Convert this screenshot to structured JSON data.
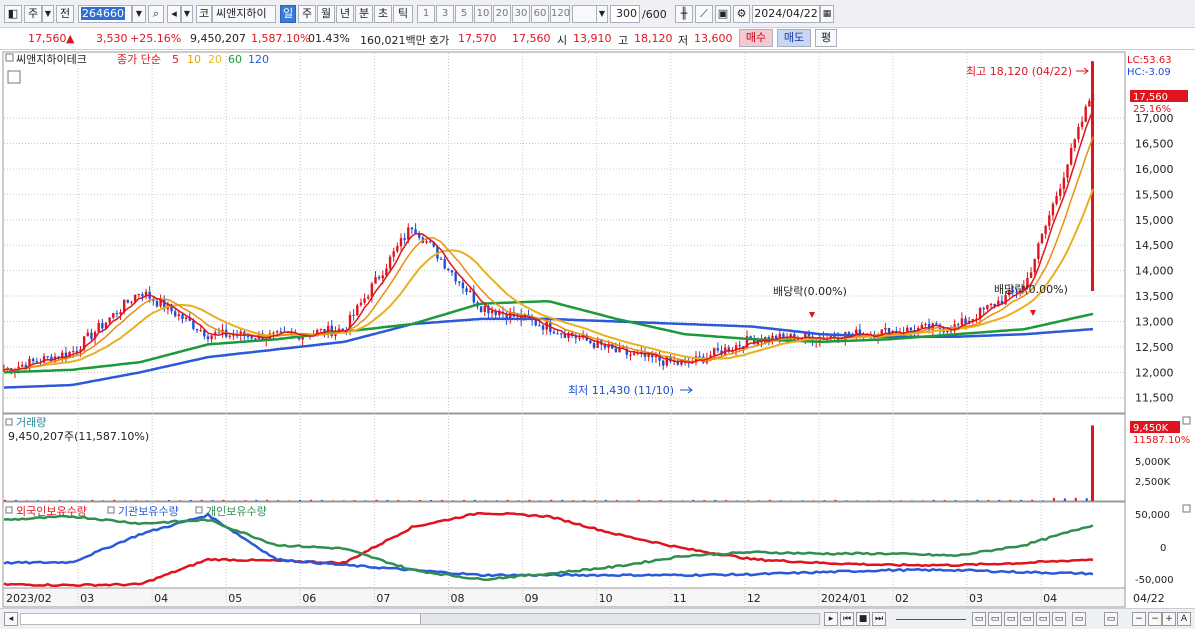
{
  "toolbar": {
    "market_label": "주",
    "prev_label": "전",
    "code": "264660",
    "stock_name": "씨앤지하이",
    "kospi_label": "코",
    "periods": [
      "일",
      "주",
      "월",
      "년",
      "분",
      "초",
      "틱"
    ],
    "minutes": [
      "1",
      "3",
      "5",
      "10",
      "20",
      "30",
      "60",
      "120"
    ],
    "count": "300",
    "count_max": "/600",
    "date": "2024/04/22"
  },
  "quote": {
    "price": "17,560",
    "change": "3,530",
    "change_pct": "+25.16%",
    "volume": "9,450,207",
    "volume_pct": "1,587.10%",
    "turnover_pct": "01.43%",
    "amount": "160,021백만",
    "ask_label": "호가",
    "ask": "17,570",
    "bid": "17,560",
    "open_label": "시",
    "open": "13,910",
    "high_label": "고",
    "high": "18,120",
    "low_label": "저",
    "low": "13,600",
    "buy_label": "매수",
    "sell_label": "매도",
    "eval_label": "평"
  },
  "legend": {
    "name": "씨앤지하이테크",
    "ma_label": "종가 단순",
    "ma": [
      {
        "period": "5",
        "color": "#e0141e"
      },
      {
        "period": "10",
        "color": "#e8a010"
      },
      {
        "period": "20",
        "color": "#e8c020"
      },
      {
        "period": "60",
        "color": "#1a9a3a"
      },
      {
        "period": "120",
        "color": "#2a5ad8"
      }
    ],
    "lc": "LC:53.63",
    "hc": "HC:-3.09"
  },
  "annotations": {
    "high": "최고 18,120 (04/22)",
    "low": "최저 11,430 (11/10)",
    "dividend1": "배당락(0.00%)",
    "dividend2": "배당락(0.00%)"
  },
  "price_tag": {
    "price": "17,560",
    "pct": "25.16%"
  },
  "volume_panel": {
    "title": "거래량",
    "value": "9,450,207주(11,587.10%)",
    "tag": "9,450K",
    "tag_pct": "11587.10%"
  },
  "holdings_panel": {
    "foreign": "외국인보유수량",
    "inst": "기관보유수량",
    "indiv": "개인보유수량"
  },
  "colors": {
    "price_line": "#e0141e",
    "candle_down": "#1d4fd6",
    "ma5": "#e0141e",
    "ma10": "#e8a010",
    "ma20": "#e8c020",
    "ma60": "#1a9a3a",
    "ma120": "#2a5ad8",
    "foreign": "#e0141e",
    "inst": "#2a5ad8",
    "indiv": "#2f8f4f"
  },
  "chart_data": [
    {
      "type": "line",
      "title": "씨앤지하이테크 일봉",
      "x": [
        "2023/02",
        "03",
        "04",
        "05",
        "06",
        "07",
        "08",
        "09",
        "10",
        "11",
        "12",
        "2024/01",
        "02",
        "03",
        "04",
        "04/22"
      ],
      "y_ticks": [
        "17,000",
        "16,500",
        "16,000",
        "15,500",
        "15,000",
        "14,500",
        "14,000",
        "13,500",
        "13,000",
        "12,500",
        "12,000",
        "11,500"
      ],
      "ylim": [
        11200,
        18300
      ],
      "series": [
        {
          "name": "종가",
          "values": [
            12050,
            12400,
            13600,
            12750,
            12700,
            12850,
            14900,
            13300,
            12900,
            12400,
            12150,
            12650,
            12700,
            12800,
            12900,
            13700,
            17560
          ]
        },
        {
          "name": "120",
          "values": [
            11700,
            11750,
            12000,
            12300,
            12450,
            12600,
            12950,
            13050,
            13050,
            13000,
            12950,
            12900,
            12750,
            12700,
            12700,
            12750,
            12850
          ]
        },
        {
          "name": "60",
          "values": [
            12000,
            12050,
            12200,
            12550,
            12650,
            12800,
            12950,
            13350,
            13400,
            13050,
            12750,
            12650,
            12600,
            12650,
            12750,
            12850,
            13150
          ]
        }
      ],
      "annotations": {
        "high": 18120,
        "low": 11430
      }
    },
    {
      "type": "bar",
      "title": "거래량",
      "y_ticks": [
        "5,000K",
        "2,500K"
      ],
      "ylim": [
        0,
        10000
      ],
      "last_value_k": 9450
    },
    {
      "type": "line",
      "title": "보유수량",
      "y_ticks": [
        "50,000",
        "0",
        "-50,000"
      ],
      "ylim": [
        -60000,
        60000
      ],
      "series": [
        {
          "name": "외국인보유수량",
          "values": [
            -55000,
            -56000,
            -55000,
            -20000,
            -22000,
            -25000,
            25000,
            45000,
            40000,
            15000,
            -5000,
            -20000,
            -25000,
            -28000,
            -28000,
            -25000,
            -20000
          ]
        },
        {
          "name": "기관보유수량",
          "values": [
            -25000,
            -24000,
            15000,
            42000,
            -20000,
            -28000,
            -35000,
            -42000,
            -42000,
            -42000,
            -42000,
            -41000,
            -38000,
            -35000,
            -35000,
            -38000,
            -40000
          ]
        },
        {
          "name": "개인보유수량",
          "values": [
            35000,
            40000,
            30000,
            35000,
            0,
            -5000,
            -35000,
            -48000,
            -40000,
            -30000,
            -15000,
            -10000,
            -12000,
            -12000,
            -15000,
            0,
            28000
          ]
        }
      ]
    }
  ]
}
